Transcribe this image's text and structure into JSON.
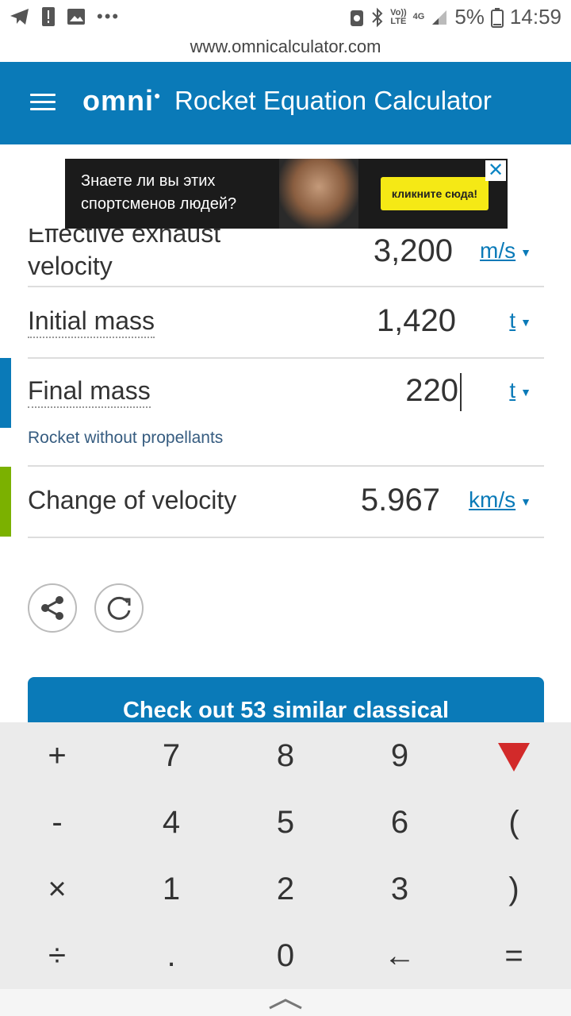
{
  "status_bar": {
    "battery_percent": "5%",
    "time": "14:59",
    "volte": "Vo))\nLTE",
    "network": "4G"
  },
  "url": "www.omnicalculator.com",
  "header": {
    "logo": "omni",
    "title": "Rocket Equation Calculator"
  },
  "ad": {
    "line1": "Знаете ли вы этих",
    "line2": "спортсменов людей?",
    "cta": "кликните сюда!",
    "close": "✕"
  },
  "fields": [
    {
      "label_top": "Effective exhaust",
      "label": "velocity",
      "value": "3,200",
      "unit": "m/s"
    },
    {
      "label": "Initial mass",
      "value": "1,420",
      "unit": "t"
    },
    {
      "label": "Final mass",
      "value": "220",
      "unit": "t",
      "hint": "Rocket without propellants"
    },
    {
      "label": "Change of velocity",
      "value": "5.967",
      "unit": "km/s"
    }
  ],
  "banner": "Check out 53 similar classical",
  "keypad": [
    [
      "+",
      "7",
      "8",
      "9",
      "▼"
    ],
    [
      "-",
      "4",
      "5",
      "6",
      "("
    ],
    [
      "×",
      "1",
      "2",
      "3",
      ")"
    ],
    [
      "÷",
      ".",
      "0",
      "←",
      "="
    ]
  ],
  "colors": {
    "brand": "#0a7ab8",
    "accent_input": "#0a7ab8",
    "accent_result": "#7bb100",
    "keypad_arrow": "#d22a2a"
  }
}
